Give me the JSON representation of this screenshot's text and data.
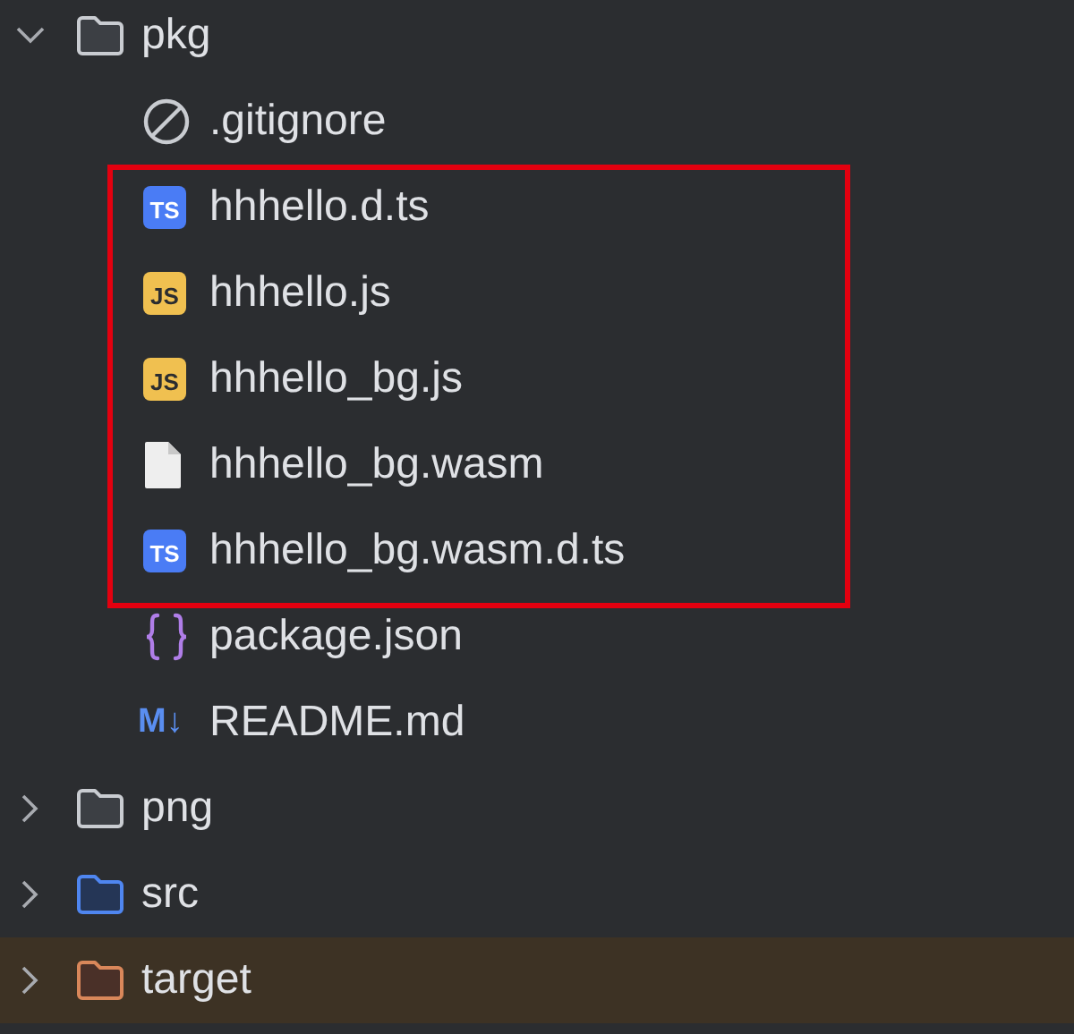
{
  "tree": [
    {
      "kind": "folder",
      "name": "pkg",
      "expanded": true,
      "children": [
        {
          "kind": "ignore",
          "name": ".gitignore",
          "highlighted": false
        },
        {
          "kind": "typescript",
          "name": "hhhello.d.ts",
          "badge": "TS",
          "highlighted": true
        },
        {
          "kind": "javascript",
          "name": "hhhello.js",
          "badge": "JS",
          "highlighted": true
        },
        {
          "kind": "javascript",
          "name": "hhhello_bg.js",
          "badge": "JS",
          "highlighted": true
        },
        {
          "kind": "binary",
          "name": "hhhello_bg.wasm",
          "highlighted": true
        },
        {
          "kind": "typescript",
          "name": "hhhello_bg.wasm.d.ts",
          "badge": "TS",
          "highlighted": true
        },
        {
          "kind": "json",
          "name": "package.json",
          "highlighted": false
        },
        {
          "kind": "markdown",
          "name": "README.md",
          "badge": "M↓",
          "highlighted": false
        }
      ]
    },
    {
      "kind": "folder",
      "name": "png",
      "expanded": false
    },
    {
      "kind": "source",
      "name": "src",
      "expanded": false
    },
    {
      "kind": "excluded",
      "name": "target",
      "expanded": false
    }
  ]
}
